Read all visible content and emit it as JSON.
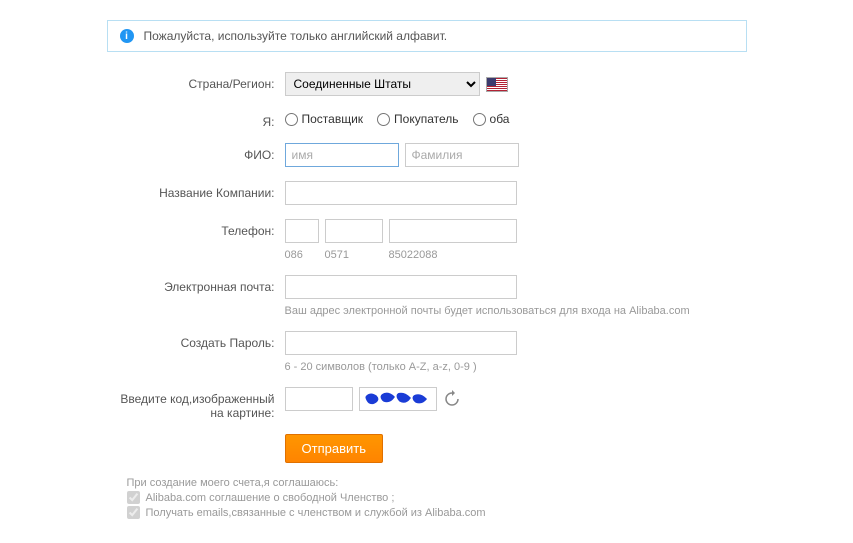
{
  "alert": {
    "text": "Пожалуйста, используйте только английский алфавит."
  },
  "labels": {
    "country": "Страна/Регион:",
    "iam": "Я:",
    "fullname": "ФИО:",
    "company": "Название Компании:",
    "phone": "Телефон:",
    "email": "Электронная почта:",
    "password": "Создать Пароль:",
    "captcha": "Введите код,изображенный на картине:"
  },
  "country_options": {
    "selected": "Соединенные Штаты"
  },
  "iam_options": {
    "supplier": "Поставщик",
    "buyer": "Покупатель",
    "both": "оба"
  },
  "placeholders": {
    "firstname": "имя",
    "lastname": "Фамилия"
  },
  "phone_hints": {
    "country": "086",
    "area": "0571",
    "number": "85022088"
  },
  "hints": {
    "email": "Ваш адрес электронной почты будет использоваться для входа на Alibaba.com",
    "password": "6 - 20 символов (только A-Z, a-z, 0-9 )"
  },
  "submit": {
    "label": "Отправить"
  },
  "terms": {
    "intro": "При создание моего счета,я соглашаюсь:",
    "line1": "Alibaba.com соглашение о свободной Членство ;",
    "line2": "Получать emails,связанные с членством и службой из Alibaba.com"
  }
}
